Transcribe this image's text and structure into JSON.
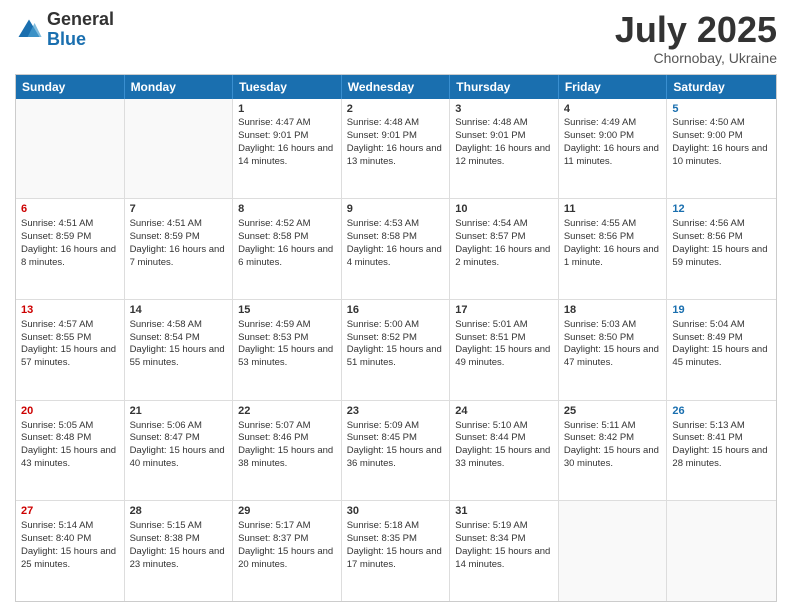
{
  "logo": {
    "general": "General",
    "blue": "Blue"
  },
  "title": "July 2025",
  "subtitle": "Chornobay, Ukraine",
  "days": [
    "Sunday",
    "Monday",
    "Tuesday",
    "Wednesday",
    "Thursday",
    "Friday",
    "Saturday"
  ],
  "rows": [
    [
      {
        "day": null,
        "type": "empty"
      },
      {
        "day": null,
        "type": "empty"
      },
      {
        "day": "1",
        "sunrise": "Sunrise: 4:47 AM",
        "sunset": "Sunset: 9:01 PM",
        "daylight": "Daylight: 16 hours and 14 minutes.",
        "type": "weekday"
      },
      {
        "day": "2",
        "sunrise": "Sunrise: 4:48 AM",
        "sunset": "Sunset: 9:01 PM",
        "daylight": "Daylight: 16 hours and 13 minutes.",
        "type": "weekday"
      },
      {
        "day": "3",
        "sunrise": "Sunrise: 4:48 AM",
        "sunset": "Sunset: 9:01 PM",
        "daylight": "Daylight: 16 hours and 12 minutes.",
        "type": "weekday"
      },
      {
        "day": "4",
        "sunrise": "Sunrise: 4:49 AM",
        "sunset": "Sunset: 9:00 PM",
        "daylight": "Daylight: 16 hours and 11 minutes.",
        "type": "weekday"
      },
      {
        "day": "5",
        "sunrise": "Sunrise: 4:50 AM",
        "sunset": "Sunset: 9:00 PM",
        "daylight": "Daylight: 16 hours and 10 minutes.",
        "type": "saturday"
      }
    ],
    [
      {
        "day": "6",
        "sunrise": "Sunrise: 4:51 AM",
        "sunset": "Sunset: 8:59 PM",
        "daylight": "Daylight: 16 hours and 8 minutes.",
        "type": "sunday"
      },
      {
        "day": "7",
        "sunrise": "Sunrise: 4:51 AM",
        "sunset": "Sunset: 8:59 PM",
        "daylight": "Daylight: 16 hours and 7 minutes.",
        "type": "weekday"
      },
      {
        "day": "8",
        "sunrise": "Sunrise: 4:52 AM",
        "sunset": "Sunset: 8:58 PM",
        "daylight": "Daylight: 16 hours and 6 minutes.",
        "type": "weekday"
      },
      {
        "day": "9",
        "sunrise": "Sunrise: 4:53 AM",
        "sunset": "Sunset: 8:58 PM",
        "daylight": "Daylight: 16 hours and 4 minutes.",
        "type": "weekday"
      },
      {
        "day": "10",
        "sunrise": "Sunrise: 4:54 AM",
        "sunset": "Sunset: 8:57 PM",
        "daylight": "Daylight: 16 hours and 2 minutes.",
        "type": "weekday"
      },
      {
        "day": "11",
        "sunrise": "Sunrise: 4:55 AM",
        "sunset": "Sunset: 8:56 PM",
        "daylight": "Daylight: 16 hours and 1 minute.",
        "type": "weekday"
      },
      {
        "day": "12",
        "sunrise": "Sunrise: 4:56 AM",
        "sunset": "Sunset: 8:56 PM",
        "daylight": "Daylight: 15 hours and 59 minutes.",
        "type": "saturday"
      }
    ],
    [
      {
        "day": "13",
        "sunrise": "Sunrise: 4:57 AM",
        "sunset": "Sunset: 8:55 PM",
        "daylight": "Daylight: 15 hours and 57 minutes.",
        "type": "sunday"
      },
      {
        "day": "14",
        "sunrise": "Sunrise: 4:58 AM",
        "sunset": "Sunset: 8:54 PM",
        "daylight": "Daylight: 15 hours and 55 minutes.",
        "type": "weekday"
      },
      {
        "day": "15",
        "sunrise": "Sunrise: 4:59 AM",
        "sunset": "Sunset: 8:53 PM",
        "daylight": "Daylight: 15 hours and 53 minutes.",
        "type": "weekday"
      },
      {
        "day": "16",
        "sunrise": "Sunrise: 5:00 AM",
        "sunset": "Sunset: 8:52 PM",
        "daylight": "Daylight: 15 hours and 51 minutes.",
        "type": "weekday"
      },
      {
        "day": "17",
        "sunrise": "Sunrise: 5:01 AM",
        "sunset": "Sunset: 8:51 PM",
        "daylight": "Daylight: 15 hours and 49 minutes.",
        "type": "weekday"
      },
      {
        "day": "18",
        "sunrise": "Sunrise: 5:03 AM",
        "sunset": "Sunset: 8:50 PM",
        "daylight": "Daylight: 15 hours and 47 minutes.",
        "type": "weekday"
      },
      {
        "day": "19",
        "sunrise": "Sunrise: 5:04 AM",
        "sunset": "Sunset: 8:49 PM",
        "daylight": "Daylight: 15 hours and 45 minutes.",
        "type": "saturday"
      }
    ],
    [
      {
        "day": "20",
        "sunrise": "Sunrise: 5:05 AM",
        "sunset": "Sunset: 8:48 PM",
        "daylight": "Daylight: 15 hours and 43 minutes.",
        "type": "sunday"
      },
      {
        "day": "21",
        "sunrise": "Sunrise: 5:06 AM",
        "sunset": "Sunset: 8:47 PM",
        "daylight": "Daylight: 15 hours and 40 minutes.",
        "type": "weekday"
      },
      {
        "day": "22",
        "sunrise": "Sunrise: 5:07 AM",
        "sunset": "Sunset: 8:46 PM",
        "daylight": "Daylight: 15 hours and 38 minutes.",
        "type": "weekday"
      },
      {
        "day": "23",
        "sunrise": "Sunrise: 5:09 AM",
        "sunset": "Sunset: 8:45 PM",
        "daylight": "Daylight: 15 hours and 36 minutes.",
        "type": "weekday"
      },
      {
        "day": "24",
        "sunrise": "Sunrise: 5:10 AM",
        "sunset": "Sunset: 8:44 PM",
        "daylight": "Daylight: 15 hours and 33 minutes.",
        "type": "weekday"
      },
      {
        "day": "25",
        "sunrise": "Sunrise: 5:11 AM",
        "sunset": "Sunset: 8:42 PM",
        "daylight": "Daylight: 15 hours and 30 minutes.",
        "type": "weekday"
      },
      {
        "day": "26",
        "sunrise": "Sunrise: 5:13 AM",
        "sunset": "Sunset: 8:41 PM",
        "daylight": "Daylight: 15 hours and 28 minutes.",
        "type": "saturday"
      }
    ],
    [
      {
        "day": "27",
        "sunrise": "Sunrise: 5:14 AM",
        "sunset": "Sunset: 8:40 PM",
        "daylight": "Daylight: 15 hours and 25 minutes.",
        "type": "sunday"
      },
      {
        "day": "28",
        "sunrise": "Sunrise: 5:15 AM",
        "sunset": "Sunset: 8:38 PM",
        "daylight": "Daylight: 15 hours and 23 minutes.",
        "type": "weekday"
      },
      {
        "day": "29",
        "sunrise": "Sunrise: 5:17 AM",
        "sunset": "Sunset: 8:37 PM",
        "daylight": "Daylight: 15 hours and 20 minutes.",
        "type": "weekday"
      },
      {
        "day": "30",
        "sunrise": "Sunrise: 5:18 AM",
        "sunset": "Sunset: 8:35 PM",
        "daylight": "Daylight: 15 hours and 17 minutes.",
        "type": "weekday"
      },
      {
        "day": "31",
        "sunrise": "Sunrise: 5:19 AM",
        "sunset": "Sunset: 8:34 PM",
        "daylight": "Daylight: 15 hours and 14 minutes.",
        "type": "weekday"
      },
      {
        "day": null,
        "type": "empty"
      },
      {
        "day": null,
        "type": "empty"
      }
    ]
  ]
}
